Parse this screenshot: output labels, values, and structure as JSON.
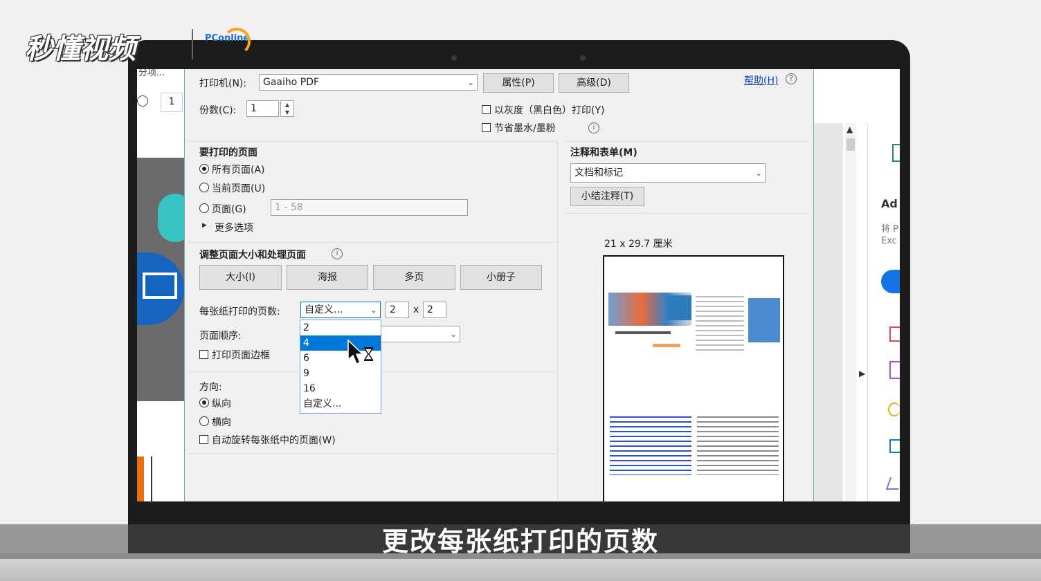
{
  "watermark": {
    "brand": "秒懂视频",
    "partner": "PConline"
  },
  "background": {
    "left_tab_text": "分项...",
    "page_box": "1",
    "right_panel_heading": "Ad",
    "right_panel_line1": "将 P",
    "right_panel_line2": "Exc"
  },
  "dialog": {
    "printer_label": "打印机(N):",
    "printer_value": "Gaaiho PDF",
    "properties_button": "属性(P)",
    "advanced_button": "高级(D)",
    "help_link": "帮助(H)",
    "copies_label": "份数(C):",
    "copies_value": "1",
    "grayscale_label": "以灰度（黑白色）打印(Y)",
    "save_ink_label": "节省墨水/墨粉",
    "pages_heading": "要打印的页面",
    "all_pages": "所有页面(A)",
    "current_page": "当前页面(U)",
    "pages_option": "页面(G)",
    "pages_range": "1 - 58",
    "more_options": "更多选项",
    "resize_heading": "调整页面大小和处理页面",
    "tab_size": "大小(I)",
    "tab_poster": "海报",
    "tab_multiple": "多页",
    "tab_booklet": "小册子",
    "pages_per_sheet_label": "每张纸打印的页数:",
    "pages_per_sheet_value": "自定义...",
    "custom_cols": "2",
    "custom_times": "x",
    "custom_rows": "2",
    "dropdown_options": [
      "2",
      "4",
      "6",
      "9",
      "16",
      "自定义..."
    ],
    "page_order_label": "页面顺序:",
    "print_border_label": "打印页面边框",
    "orientation_heading": "方向:",
    "portrait": "纵向",
    "landscape": "横向",
    "auto_rotate": "自动旋转每张纸中的页面(W)",
    "comments_heading": "注释和表单(M)",
    "comments_value": "文档和标记",
    "summarize_button": "小结注释(T)",
    "paper_size": "21 x 29.7 厘米"
  },
  "subtitle": "更改每张纸打印的页数"
}
